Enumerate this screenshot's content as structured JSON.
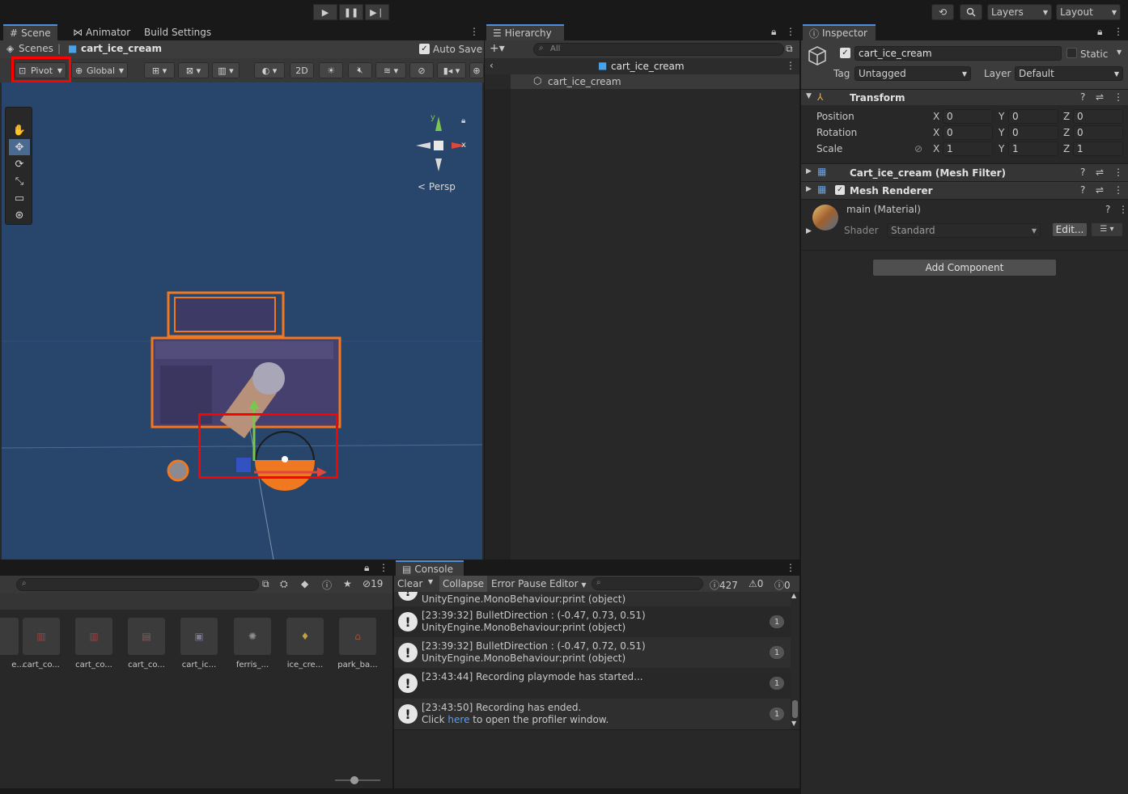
{
  "toolbar_top": {
    "play_icon": "play-icon",
    "pause_icon": "pause-icon",
    "step_icon": "step-icon",
    "layers_label": "Layers",
    "layout_label": "Layout"
  },
  "scene": {
    "tabs": [
      "Scene",
      "Animator",
      "Build Settings"
    ],
    "breadcrumb_root": "Scenes",
    "breadcrumb_current": "cart_ice_cream",
    "auto_save": "Auto Save",
    "pivot_label": "Pivot",
    "global_label": "Global",
    "mode_2d": "2D",
    "persp_label": "Persp",
    "gizmo_x": "x",
    "gizmo_y": "y"
  },
  "hierarchy": {
    "tab": "Hierarchy",
    "search_placeholder": "All",
    "root": "cart_ice_cream",
    "child": "cart_ice_cream"
  },
  "inspector": {
    "tab": "Inspector",
    "object_name": "cart_ice_cream",
    "static_label": "Static",
    "tag_label": "Tag",
    "tag_value": "Untagged",
    "layer_label": "Layer",
    "layer_value": "Default",
    "transform": {
      "title": "Transform",
      "position_label": "Position",
      "rotation_label": "Rotation",
      "scale_label": "Scale",
      "position": {
        "x": "0",
        "y": "0",
        "z": "0"
      },
      "rotation": {
        "x": "0",
        "y": "0",
        "z": "0"
      },
      "scale": {
        "x": "1",
        "y": "1",
        "z": "1"
      },
      "axis_x": "X",
      "axis_y": "Y",
      "axis_z": "Z"
    },
    "mesh_filter": "Cart_ice_cream (Mesh Filter)",
    "mesh_renderer": "Mesh Renderer",
    "material_name": "main (Material)",
    "shader_label": "Shader",
    "shader_value": "Standard",
    "edit_label": "Edit...",
    "add_component": "Add Component"
  },
  "project": {
    "hidden_count": "19",
    "assets": [
      {
        "label": "e..."
      },
      {
        "label": "cart_co..."
      },
      {
        "label": "cart_co..."
      },
      {
        "label": "cart_co..."
      },
      {
        "label": "cart_ic..."
      },
      {
        "label": "ferris_..."
      },
      {
        "label": "ice_cre..."
      },
      {
        "label": "park_ba..."
      }
    ]
  },
  "console": {
    "tab": "Console",
    "clear": "Clear",
    "collapse": "Collapse",
    "error_pause": "Error Pause",
    "editor": "Editor",
    "count_log": "427",
    "count_warn": "0",
    "count_error": "0",
    "partial_row": "UnityEngine.MonoBehaviour:print (object)",
    "rows": [
      {
        "line1": "[23:39:32] BulletDirection : (-0.47, 0.73, 0.51)",
        "line2": "UnityEngine.MonoBehaviour:print (object)",
        "count": "1"
      },
      {
        "line1": "[23:39:32] BulletDirection : (-0.47, 0.72, 0.51)",
        "line2": "UnityEngine.MonoBehaviour:print (object)",
        "count": "1"
      },
      {
        "line1": "[23:43:44] Recording playmode has started...",
        "line2": "",
        "count": "1"
      },
      {
        "line1": "[23:43:50] Recording has ended.",
        "line2_prefix": "Click ",
        "line2_link": "here",
        "line2_suffix": " to open the profiler window.",
        "count": "1"
      }
    ]
  },
  "colors": {
    "scene_bg": "#28456c",
    "highlight_red": "#ff0000",
    "selection_orange": "#f07820",
    "accent_blue": "#4d8fdc"
  }
}
